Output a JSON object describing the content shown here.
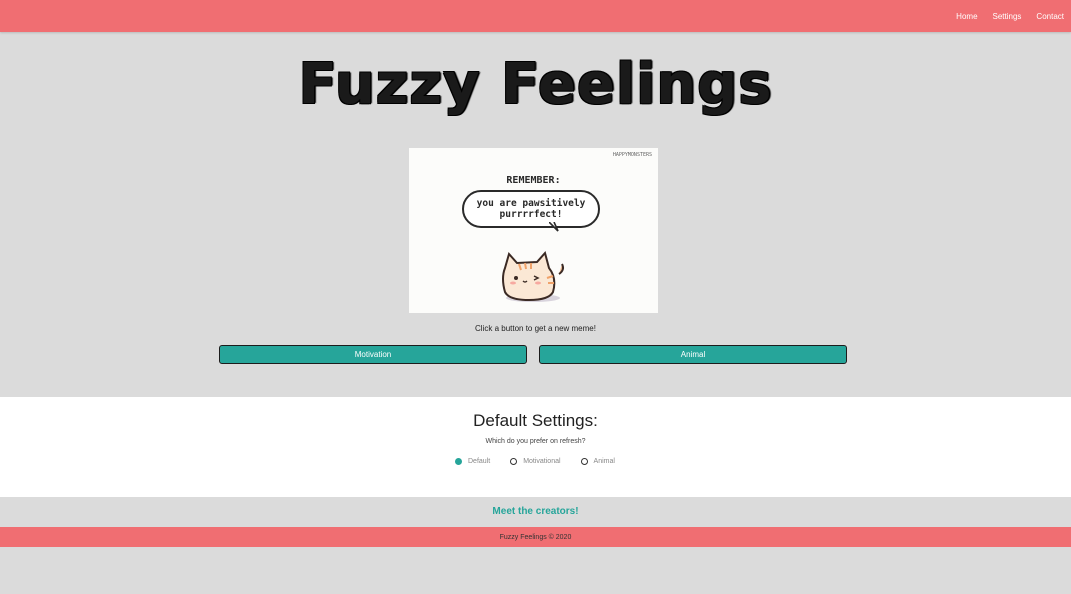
{
  "nav": {
    "items": [
      {
        "label": "Home"
      },
      {
        "label": "Settings"
      },
      {
        "label": "Contact"
      }
    ]
  },
  "header": {
    "title": "Fuzzy Feelings"
  },
  "meme": {
    "credit": "HAPPYMONSTERS",
    "heading": "REMEMBER:",
    "bubble_line1": "you are pawsitively",
    "bubble_line2": "purrrrfect!"
  },
  "main": {
    "caption": "Click a button to get a new meme!",
    "buttons": [
      {
        "label": "Motivation"
      },
      {
        "label": "Animal"
      }
    ]
  },
  "settings": {
    "title": "Default Settings:",
    "subtitle": "Which do you prefer on refresh?",
    "options": [
      {
        "label": "Default",
        "checked": true
      },
      {
        "label": "Motivational",
        "checked": false
      },
      {
        "label": "Animal",
        "checked": false
      }
    ]
  },
  "creators": {
    "link": "Meet the creators!"
  },
  "footer": {
    "text": "Fuzzy Feelings © 2020"
  },
  "colors": {
    "accent": "#26a59a",
    "brand": "#f06e72",
    "background": "#dbdbdb"
  }
}
